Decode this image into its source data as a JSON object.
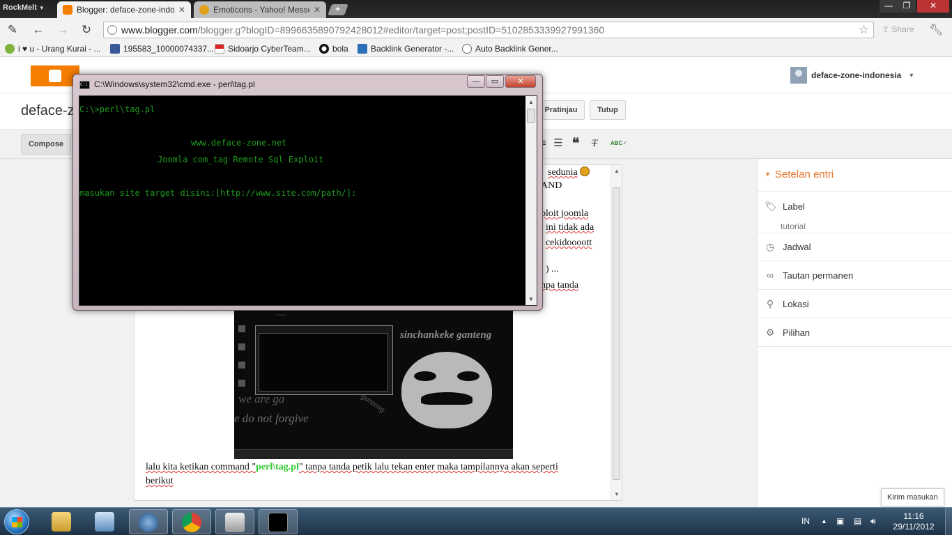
{
  "browser": {
    "menu_label": "RockMelt",
    "tabs": [
      {
        "title": "Blogger: deface-zone-indor",
        "active": true
      },
      {
        "title": "Emoticons - Yahoo! Messer",
        "active": false
      }
    ],
    "url_host": "www.blogger.com",
    "url_path": "/blogger.g?blogID=8996635890792428012#editor/target=post;postID=5102853339927991360",
    "share_label": "Share",
    "bookmarks": [
      "i ♥ u - Urang Kurai - ...",
      "195583_10000074337...",
      "Sidoarjo CyberTeam...",
      "bola",
      "Backlink Generator -...",
      "Auto Backlink Gener..."
    ]
  },
  "blogger": {
    "user_name": "deface-zone-indonesia",
    "blog_title": "deface-zo",
    "buttons": {
      "preview": "Pratinjau",
      "close": "Tutup",
      "compose": "Compose"
    },
    "editor_fragments": [
      "sedunia",
      "AND",
      "ploit joomla",
      "ini tidak ada",
      "cekidoooott",
      ")  ...",
      "npa tanda"
    ],
    "editor_paragraph": {
      "before": "lalu kita ketikan command \"",
      "command": "perl\\tag.pl",
      "after": "\" tanpa tanda petik lalu tekan enter maka tampilannya akan seperti",
      "line2": "berikut"
    },
    "screenshot_texts": [
      "sinchankeke ganteng",
      "we are ga",
      "e do not forgive",
      "ganteng"
    ],
    "sidebar": {
      "header": "Setelan entri",
      "items": [
        {
          "label": "Label",
          "icon": "tag-icon"
        },
        {
          "label": "Jadwal",
          "icon": "clock-icon"
        },
        {
          "label": "Tautan permanen",
          "icon": "link-icon"
        },
        {
          "label": "Lokasi",
          "icon": "pin-icon"
        },
        {
          "label": "Pilihan",
          "icon": "gear-icon"
        }
      ],
      "label_value": "tutorial"
    },
    "feedback": "Kirim masukan"
  },
  "cmd": {
    "title": "C:\\Windows\\system32\\cmd.exe - perl\\tag.pl",
    "lines": [
      "C:\\>perl\\tag.pl",
      "www.deface-zone.net",
      "Joomla com_tag Remote Sql Exploit",
      "masukan site target disini:[http://www.site.com/path/]:"
    ],
    "text_color": "#1e9b1e"
  },
  "taskbar": {
    "language": "IN",
    "time": "11:16",
    "date": "29/11/2012"
  },
  "colors": {
    "blogger_orange": "#f57d00",
    "sidebar_accent": "#e8772c",
    "command_green": "#2ec92e"
  }
}
